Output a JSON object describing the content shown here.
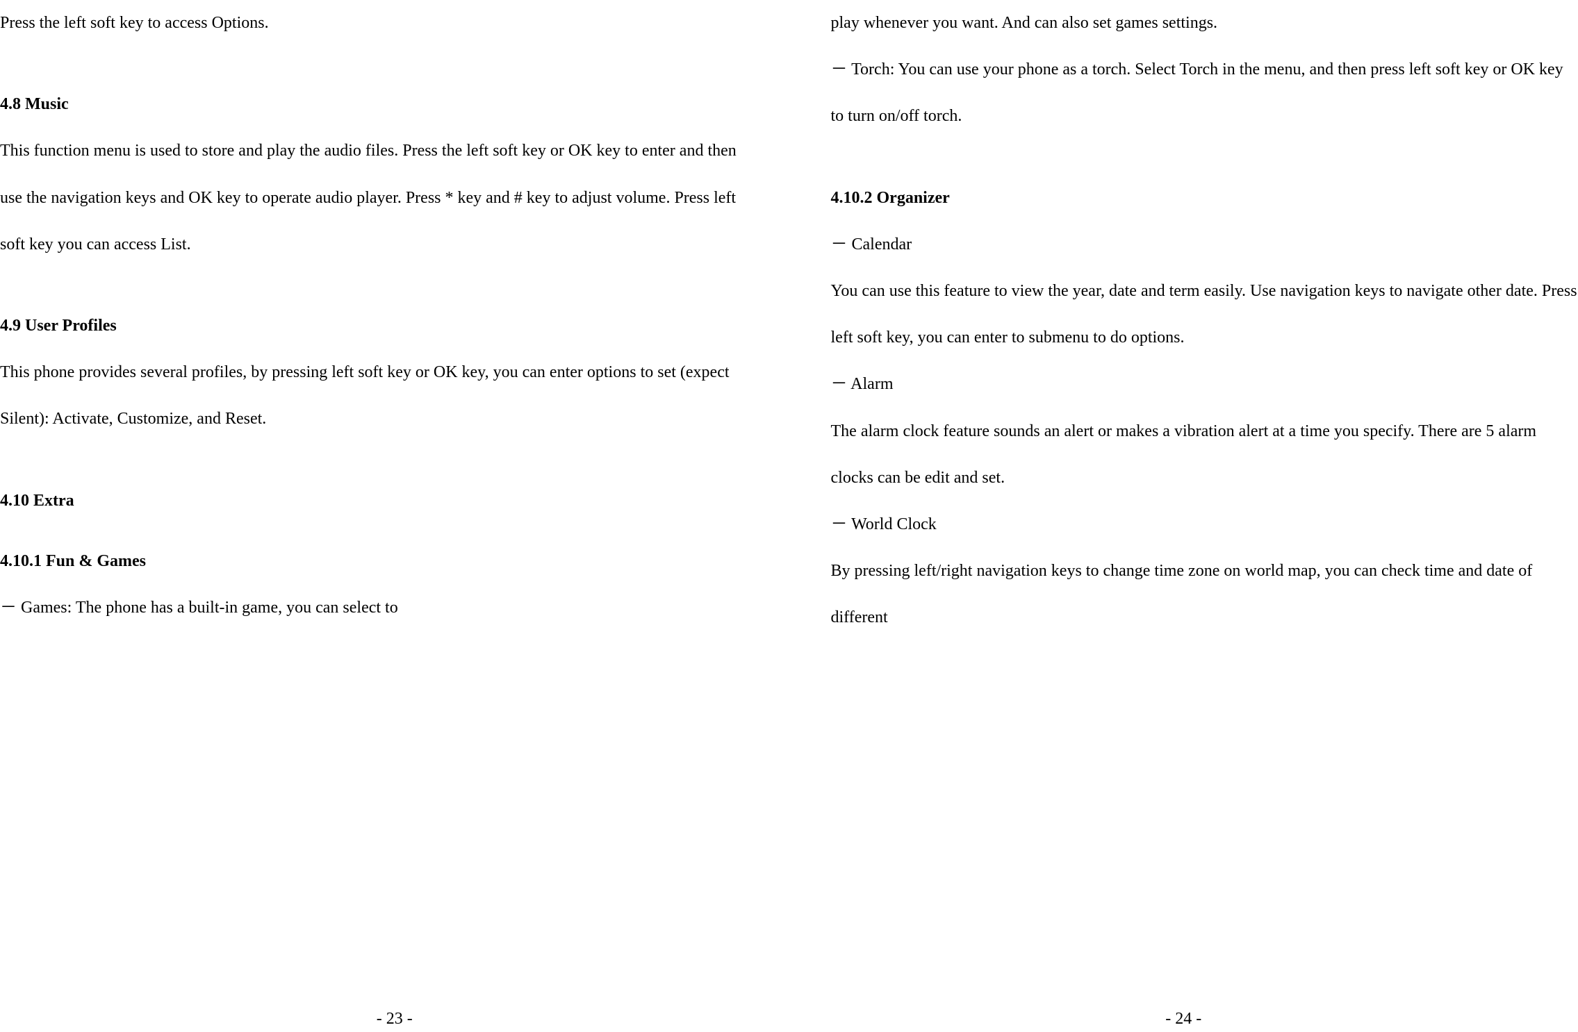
{
  "left": {
    "line1": "Press the left soft key to access Options.",
    "heading_music": "4.8 Music",
    "music_para": "This function menu is used to store and play the audio files. Press the left soft key or OK key to enter and then use the navigation keys and OK key to operate audio player. Press * key and # key to adjust volume. Press left soft key you can access List.",
    "heading_profiles": "4.9 User Profiles",
    "profiles_para": "This phone provides several profiles, by pressing left soft key or OK key, you can enter options to set (expect Silent): Activate, Customize, and Reset.",
    "heading_extra": "4.10 Extra",
    "heading_fun": "4.10.1 Fun & Games",
    "games_para": "－ Games: The phone has a built-in game, you can select to",
    "page_number": "- 23 -"
  },
  "right": {
    "line1": "play whenever you want. And can also set games settings.",
    "torch_para": "－ Torch: You can use your phone as a torch. Select Torch in the menu, and then press left soft key or OK key to turn on/off torch.",
    "heading_organizer": "4.10.2 Organizer",
    "calendar_label": "－ Calendar",
    "calendar_para": "You can use this feature to view the year, date and term easily. Use navigation keys to navigate other date. Press left soft key, you can enter to submenu to do options.",
    "alarm_label": "－ Alarm",
    "alarm_para": "The alarm clock feature sounds an alert or makes a vibration alert at a time you specify. There are 5 alarm clocks can be edit and set.",
    "world_clock_label": "－ World Clock",
    "world_clock_para": "By pressing left/right navigation keys to change time zone on world map, you can check time and date of different",
    "page_number": "- 24 -"
  }
}
